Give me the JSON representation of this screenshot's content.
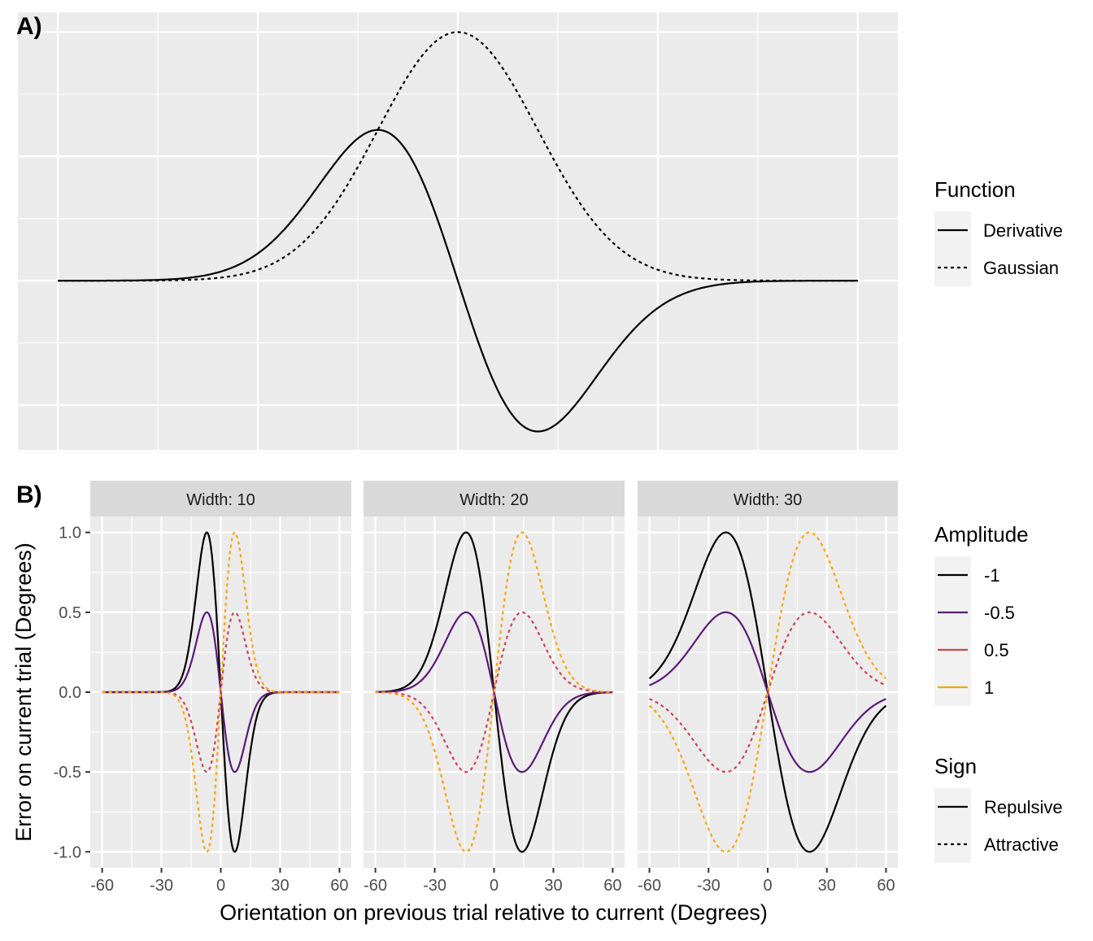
{
  "chart_data": [
    {
      "panel_label": "A)",
      "type": "line",
      "axes_visible": false,
      "grid": true,
      "xlim": [
        -5.5,
        5.5
      ],
      "ylim": [
        -0.68,
        1.08
      ],
      "legend": {
        "title": "Function",
        "placement": "right",
        "entries": [
          {
            "label": "Derivative",
            "linetype": "solid"
          },
          {
            "label": "Gaussian",
            "linetype": "dashed"
          }
        ]
      },
      "series": [
        {
          "name": "Derivative",
          "function": "-x*exp(-x^2/2)",
          "x_range": [
            -5,
            5
          ],
          "peak": 0.607,
          "trough": -0.607,
          "linetype": "solid",
          "color": "#000000"
        },
        {
          "name": "Gaussian",
          "function": "exp(-x^2/2)",
          "x_range": [
            -5,
            5
          ],
          "peak": 1.0,
          "linetype": "dashed",
          "color": "#000000"
        }
      ]
    },
    {
      "panel_label": "B)",
      "type": "line",
      "grid": true,
      "xlabel": "Orientation on previous trial relative to current (Degrees)",
      "ylabel": "Error on current trial (Degrees)",
      "xlim": [
        -66,
        66
      ],
      "ylim": [
        -1.1,
        1.1
      ],
      "xticks": [
        "-60",
        "-30",
        "0",
        "30",
        "60"
      ],
      "yticks": [
        "-1.0",
        "-0.5",
        "0.0",
        "0.5",
        "1.0"
      ],
      "x_range": [
        -60,
        60
      ],
      "function": "amplitude * (sqrt(2)*x/width) * exp(0.5 - (x/width)^2)",
      "facets": [
        {
          "label": "Width: 10",
          "width": 10
        },
        {
          "label": "Width: 20",
          "width": 20
        },
        {
          "label": "Width: 30",
          "width": 30
        }
      ],
      "series": [
        {
          "amplitude": -1,
          "label": "-1",
          "sign": "Repulsive",
          "color": "#000000"
        },
        {
          "amplitude": -0.5,
          "label": "-0.5",
          "sign": "Repulsive",
          "color": "#5a1a77"
        },
        {
          "amplitude": 0.5,
          "label": "0.5",
          "sign": "Attractive",
          "color": "#cf4456"
        },
        {
          "amplitude": 1,
          "label": "1",
          "sign": "Attractive",
          "color": "#fca50a"
        }
      ],
      "legends": [
        {
          "title": "Amplitude",
          "entries": [
            {
              "label": "-1",
              "color": "#000000"
            },
            {
              "label": "-0.5",
              "color": "#5a1a77"
            },
            {
              "label": "0.5",
              "color": "#cf4456"
            },
            {
              "label": "1",
              "color": "#fca50a"
            }
          ]
        },
        {
          "title": "Sign",
          "entries": [
            {
              "label": "Repulsive",
              "linetype": "solid"
            },
            {
              "label": "Attractive",
              "linetype": "dashed"
            }
          ]
        }
      ]
    }
  ]
}
